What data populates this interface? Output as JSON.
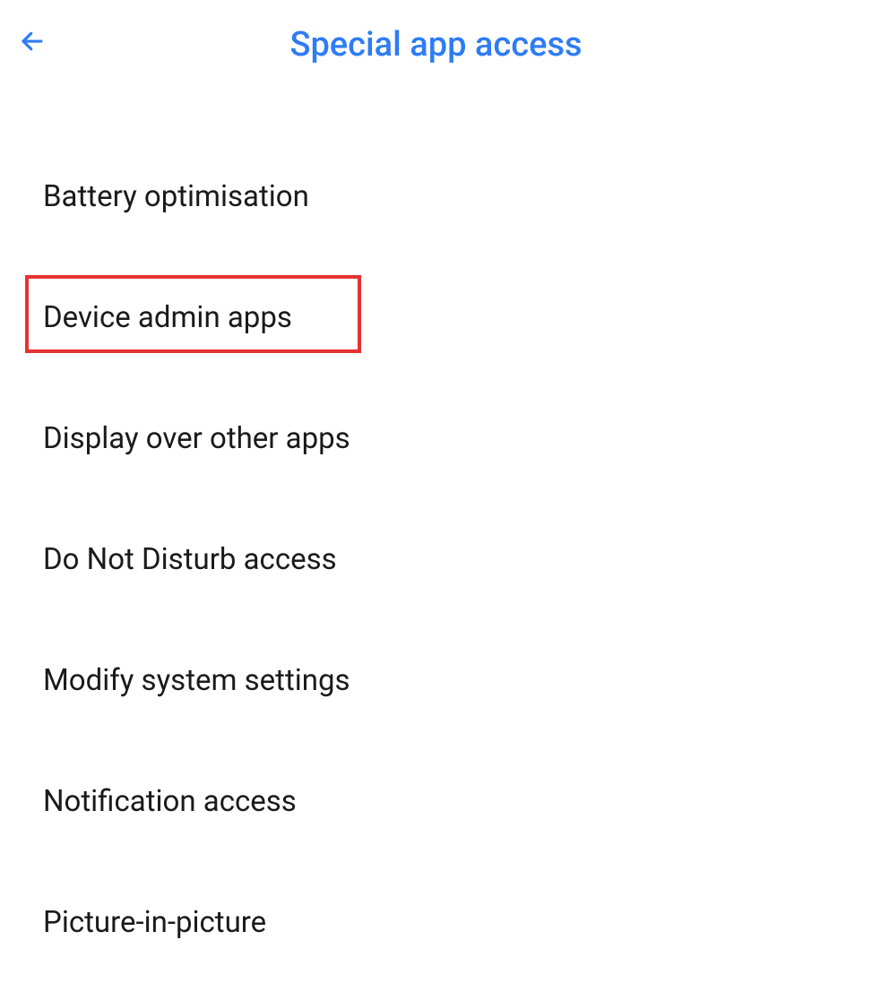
{
  "header": {
    "title": "Special app access"
  },
  "items": [
    {
      "label": "Battery optimisation",
      "highlighted": false
    },
    {
      "label": "Device admin apps",
      "highlighted": true
    },
    {
      "label": "Display over other apps",
      "highlighted": false
    },
    {
      "label": "Do Not Disturb access",
      "highlighted": false
    },
    {
      "label": "Modify system settings",
      "highlighted": false
    },
    {
      "label": "Notification access",
      "highlighted": false
    },
    {
      "label": "Picture-in-picture",
      "highlighted": false
    }
  ]
}
